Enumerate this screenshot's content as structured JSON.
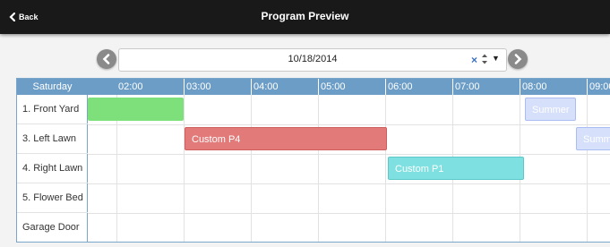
{
  "header": {
    "back_label": "Back",
    "title": "Program Preview"
  },
  "date_picker": {
    "value": "10/18/2014",
    "clear_symbol": "×",
    "dropdown_symbol": "▼"
  },
  "schedule": {
    "day": "Saturday",
    "times": [
      "02:00",
      "03:00",
      "04:00",
      "05:00",
      "06:00",
      "07:00",
      "08:00",
      "09:00"
    ],
    "resources": [
      "1. Front Yard",
      "3. Left Lawn",
      "4. Right Lawn",
      "5. Flower Bed",
      "Garage Door"
    ],
    "events": [
      {
        "resource": "1. Front Yard",
        "label": "",
        "color": "#7ee07a"
      },
      {
        "resource": "1. Front Yard",
        "label": "Summer",
        "color": "#d6e0fb"
      },
      {
        "resource": "3. Left Lawn",
        "label": "Custom P4",
        "color": "#e27a7a"
      },
      {
        "resource": "3. Left Lawn",
        "label": "Summer",
        "color": "#d6e0fb"
      },
      {
        "resource": "4. Right Lawn",
        "label": "Custom P1",
        "color": "#7ee0e0"
      }
    ]
  },
  "colors": {
    "header_bar": "#191919",
    "schedule_header": "#6b9dc7",
    "nav_button": "#8a8a8a"
  }
}
